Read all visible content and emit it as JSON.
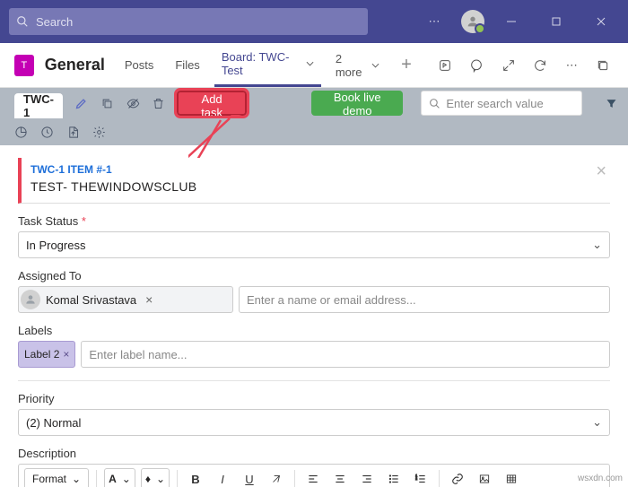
{
  "titlebar": {
    "search_placeholder": "Search"
  },
  "channel": {
    "team_initial": "T",
    "name": "General",
    "tabs": {
      "posts": "Posts",
      "files": "Files",
      "board": "Board: TWC-Test",
      "more": "2 more"
    }
  },
  "toolbar": {
    "tab": "TWC-1",
    "add_task": "Add task",
    "book_demo": "Book live demo",
    "search_placeholder": "Enter search value"
  },
  "item": {
    "id": "TWC-1 ITEM #-1",
    "title": "TEST- THEWINDOWSCLUB",
    "status_label": "Task Status",
    "status_value": "In Progress",
    "assigned_label": "Assigned To",
    "assignee": "Komal Srivastava",
    "assignee_placeholder": "Enter a name or email address...",
    "labels_label": "Labels",
    "label_chip": "Label 2",
    "label_placeholder": "Enter label name...",
    "priority_label": "Priority",
    "priority_value": "(2) Normal",
    "description_label": "Description",
    "format": "Format",
    "font_a": "A",
    "fill_a": "⬙"
  },
  "watermark": "wsxdn.com"
}
